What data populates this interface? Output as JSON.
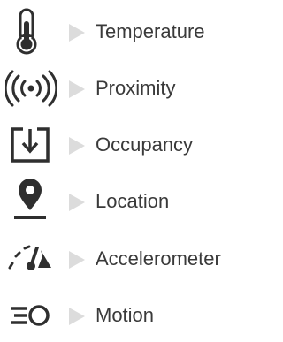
{
  "colors": {
    "icon": "#2f2f2f",
    "arrow": "#dcdcdc",
    "text": "#3a3a3a"
  },
  "items": [
    {
      "icon": "thermometer-icon",
      "label": "Temperature"
    },
    {
      "icon": "proximity-signal-icon",
      "label": "Proximity"
    },
    {
      "icon": "occupancy-box-arrow-icon",
      "label": "Occupancy"
    },
    {
      "icon": "location-pin-icon",
      "label": "Location"
    },
    {
      "icon": "speedometer-icon",
      "label": "Accelerometer"
    },
    {
      "icon": "motion-icon",
      "label": "Motion"
    }
  ]
}
